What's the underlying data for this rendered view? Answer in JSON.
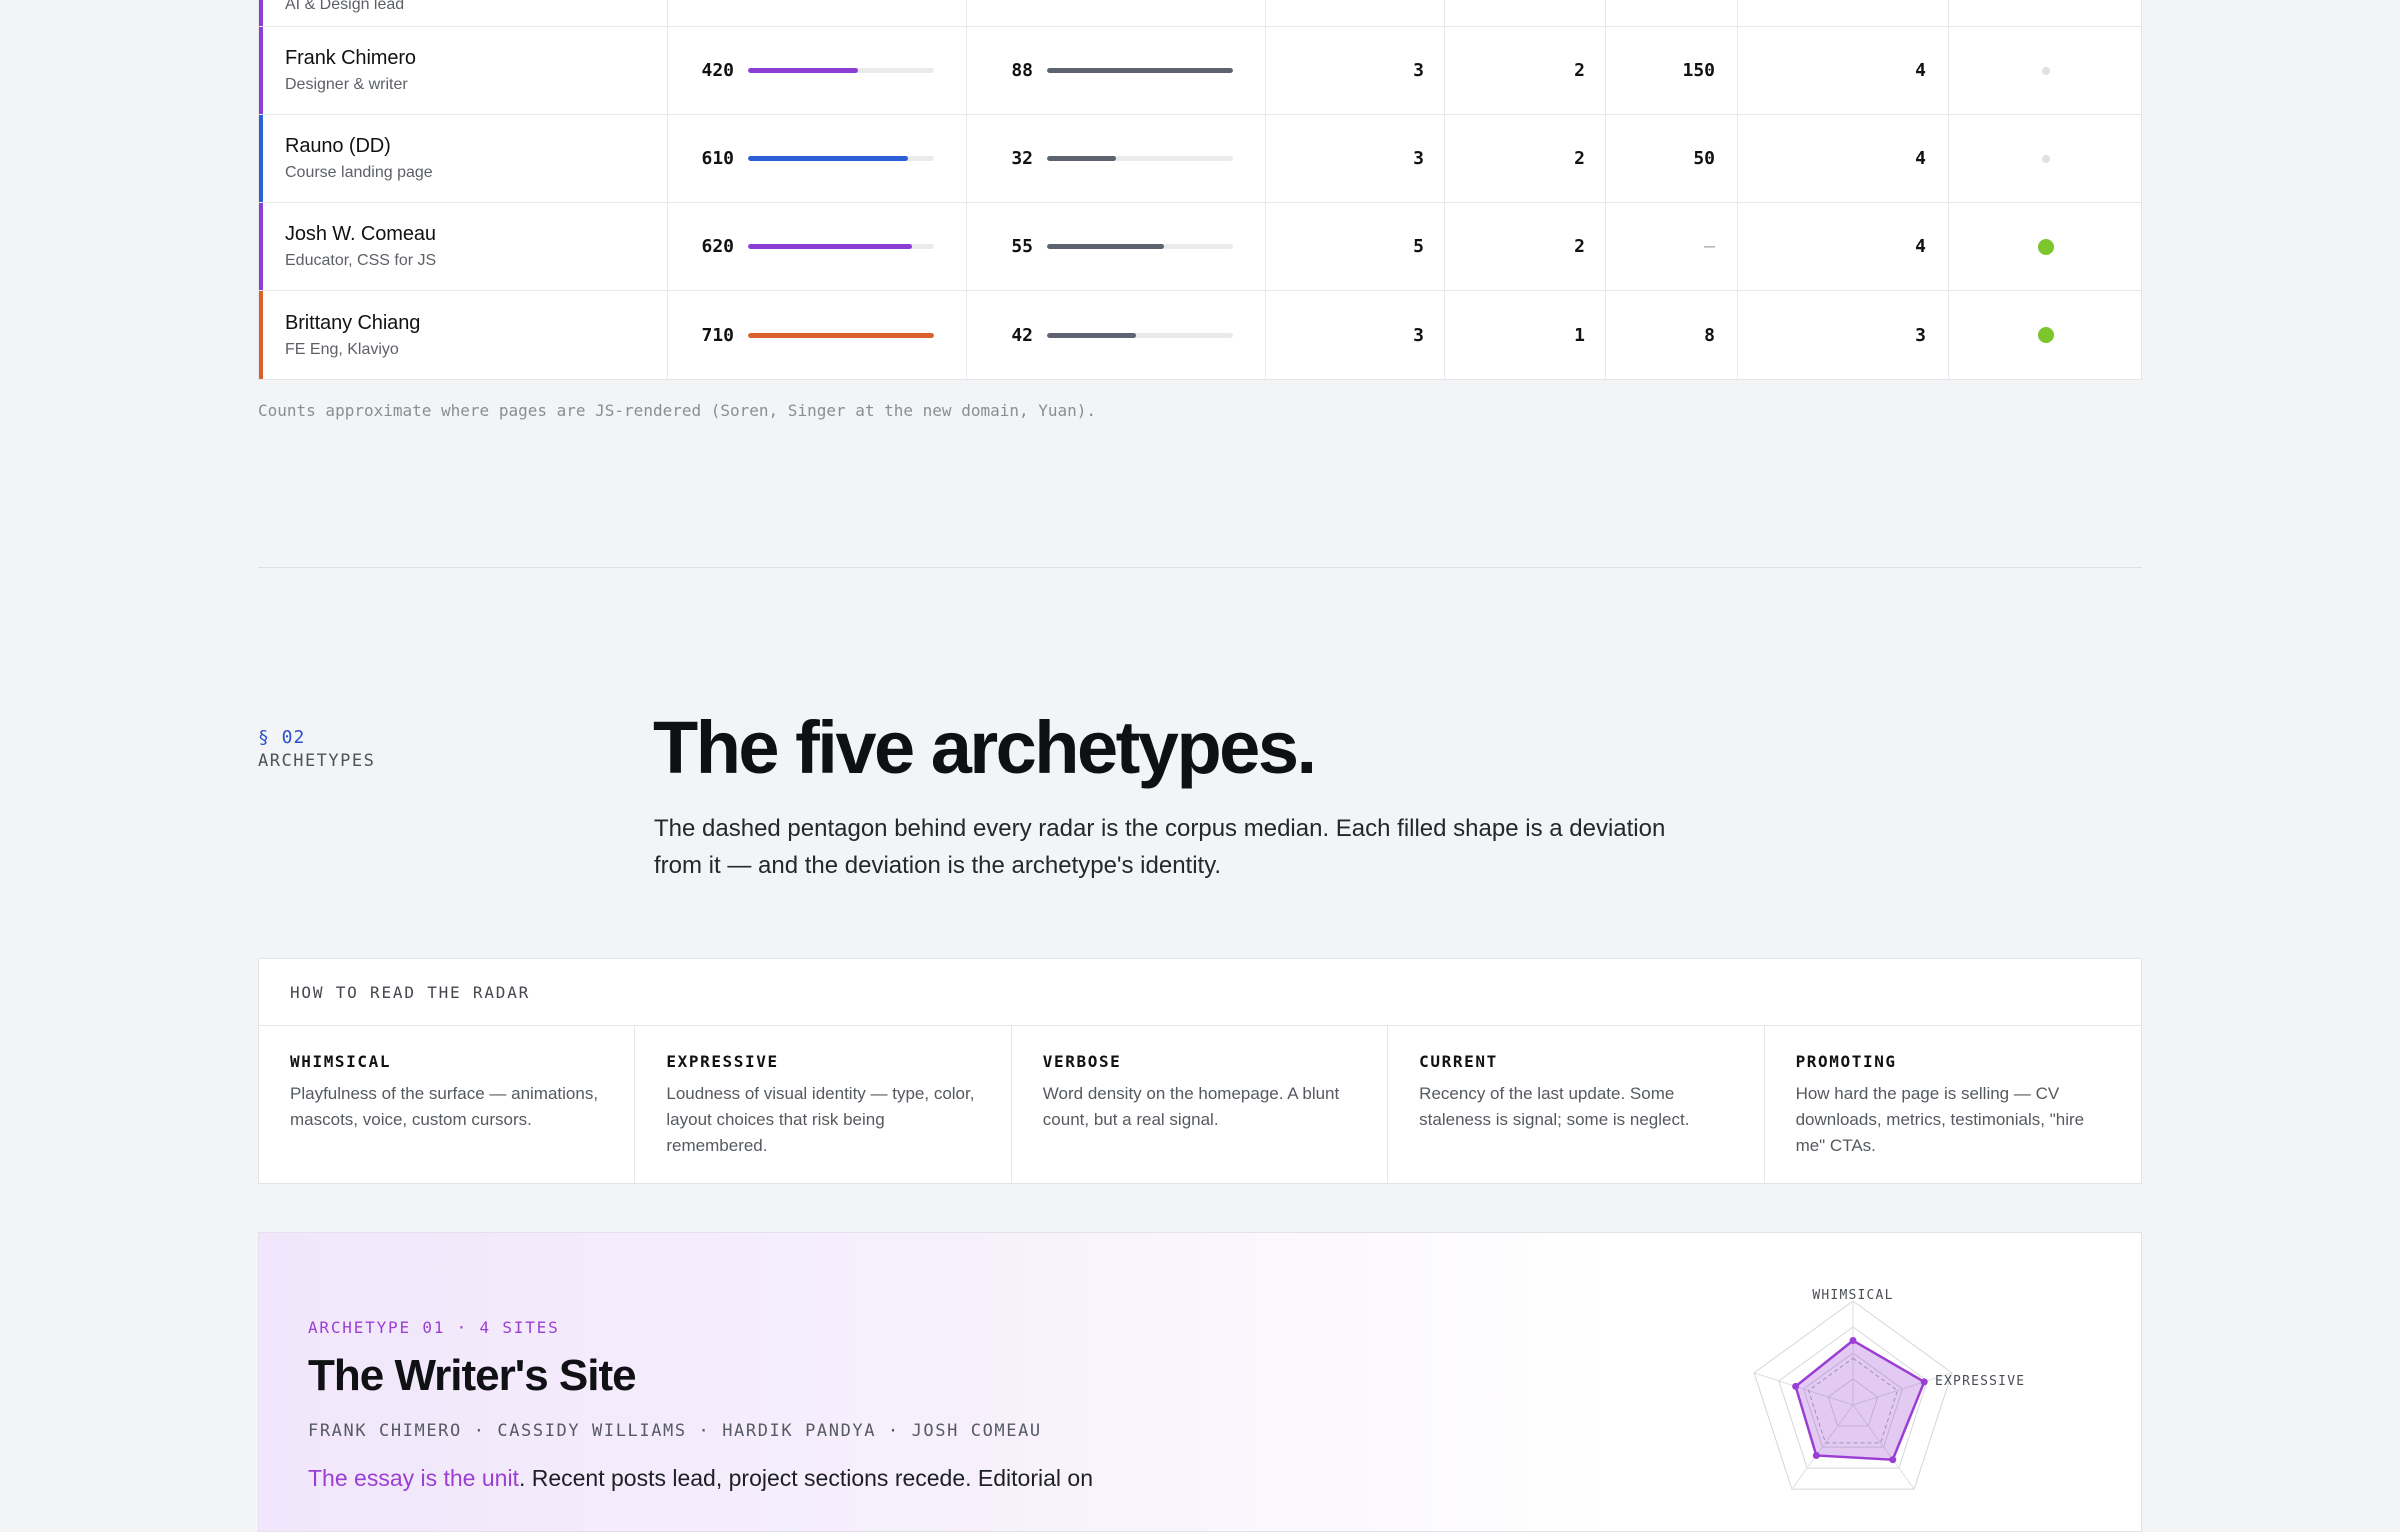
{
  "table": {
    "rows": [
      {
        "name": "",
        "role": "AI & Design lead",
        "stripe": "#8a3ed6",
        "m1": "",
        "m1_color": "#8a3ed6",
        "m1_frac": 0,
        "m2": "",
        "m2_frac": 0,
        "n1": "",
        "n2": "",
        "n3": "",
        "n4": "",
        "status": "none"
      },
      {
        "name": "Frank Chimero",
        "role": "Designer & writer",
        "stripe": "#8a3ed6",
        "m1": "420",
        "m1_color": "#8a3ed6",
        "m1_frac": 0.59,
        "m2": "88",
        "m2_frac": 1.0,
        "n1": "3",
        "n2": "2",
        "n3": "150",
        "n4": "4",
        "status": "inactive"
      },
      {
        "name": "Rauno (DD)",
        "role": "Course landing page",
        "stripe": "#2a5fd6",
        "m1": "610",
        "m1_color": "#2a5fd6",
        "m1_frac": 0.86,
        "m2": "32",
        "m2_frac": 0.37,
        "n1": "3",
        "n2": "2",
        "n3": "50",
        "n4": "4",
        "status": "inactive"
      },
      {
        "name": "Josh W. Comeau",
        "role": "Educator, CSS for JS",
        "stripe": "#8a3ed6",
        "m1": "620",
        "m1_color": "#8a3ed6",
        "m1_frac": 0.88,
        "m2": "55",
        "m2_frac": 0.63,
        "n1": "5",
        "n2": "2",
        "n3": "—",
        "n4": "4",
        "status": "active"
      },
      {
        "name": "Brittany Chiang",
        "role": "FE Eng, Klaviyo",
        "stripe": "#d9622a",
        "m1": "710",
        "m1_color": "#d9622a",
        "m1_frac": 1.0,
        "m2": "42",
        "m2_frac": 0.48,
        "n1": "3",
        "n2": "1",
        "n3": "8",
        "n4": "3",
        "status": "active"
      }
    ],
    "m2_color": "#5d6470",
    "footnote": "Counts approximate where pages are JS-rendered (Soren, Singer at the new domain, Yuan)."
  },
  "section": {
    "number": "§ 02",
    "label": "ARCHETYPES",
    "title": "The five archetypes.",
    "lede": "The dashed pentagon behind every radar is the corpus median. Each filled shape is a deviation from it — and the deviation is the archetype's identity."
  },
  "howto": {
    "heading": "HOW TO READ THE RADAR",
    "items": [
      {
        "key": "WHIMSICAL",
        "desc": "Playfulness of the surface — animations, mascots, voice, custom cursors."
      },
      {
        "key": "EXPRESSIVE",
        "desc": "Loudness of visual identity — type, color, layout choices that risk being remembered."
      },
      {
        "key": "VERBOSE",
        "desc": "Word density on the homepage. A blunt count, but a real signal."
      },
      {
        "key": "CURRENT",
        "desc": "Recency of the last update. Some staleness is signal; some is neglect."
      },
      {
        "key": "PROMOTING",
        "desc": "How hard the page is selling — CV downloads, metrics, testimonials, \"hire me\" CTAs."
      }
    ]
  },
  "archetype": {
    "eyebrow": "ARCHETYPE 01 · 4 SITES",
    "title": "The Writer's Site",
    "sites": "FRANK CHIMERO · CASSIDY WILLIAMS · HARDIK PANDYA · JOSH COMEAU",
    "desc_highlight": "The essay is the unit",
    "desc_rest": ". Recent posts lead, project sections recede. Editorial on",
    "accent": "#9b3fd4",
    "radar": {
      "axes": [
        "WHIMSICAL",
        "EXPRESSIVE"
      ],
      "values": [
        0.62,
        0.72,
        0.65,
        0.6,
        0.58
      ]
    }
  }
}
